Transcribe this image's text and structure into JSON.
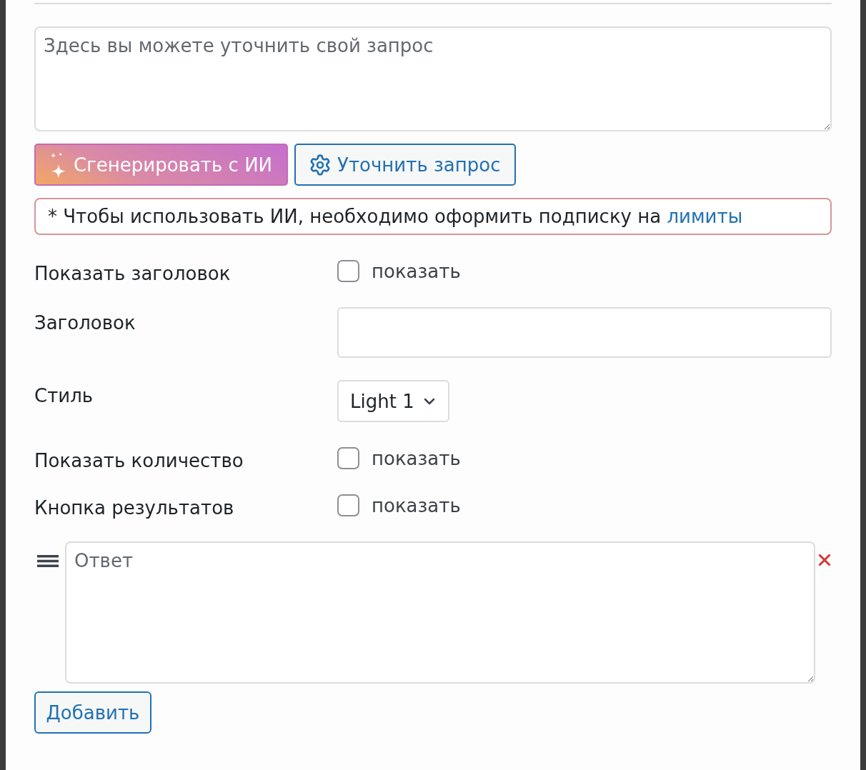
{
  "prompt": {
    "placeholder": "Здесь вы можете уточнить свой запрос"
  },
  "actions": [
    {
      "kind": "ai",
      "label": "Сгенерировать с ИИ"
    },
    {
      "kind": "refine",
      "label": "Уточнить запрос"
    }
  ],
  "notice": {
    "text": "* Чтобы использовать ИИ, необходимо оформить подписку на",
    "link": "лимиты"
  },
  "fields": [
    {
      "kind": "checkbox",
      "label": "Показать заголовок",
      "option": "показать",
      "checked": false
    },
    {
      "kind": "text",
      "label": "Заголовок"
    },
    {
      "kind": "select",
      "label": "Стиль",
      "value": "Light 1"
    },
    {
      "kind": "checkbox",
      "label": "Показать количество",
      "option": "показать",
      "checked": false
    },
    {
      "kind": "checkbox",
      "label": "Кнопка результатов",
      "option": "показать",
      "checked": false
    }
  ],
  "answers": [
    {
      "placeholder": "Ответ"
    }
  ],
  "add_button": {
    "label": "Добавить"
  }
}
